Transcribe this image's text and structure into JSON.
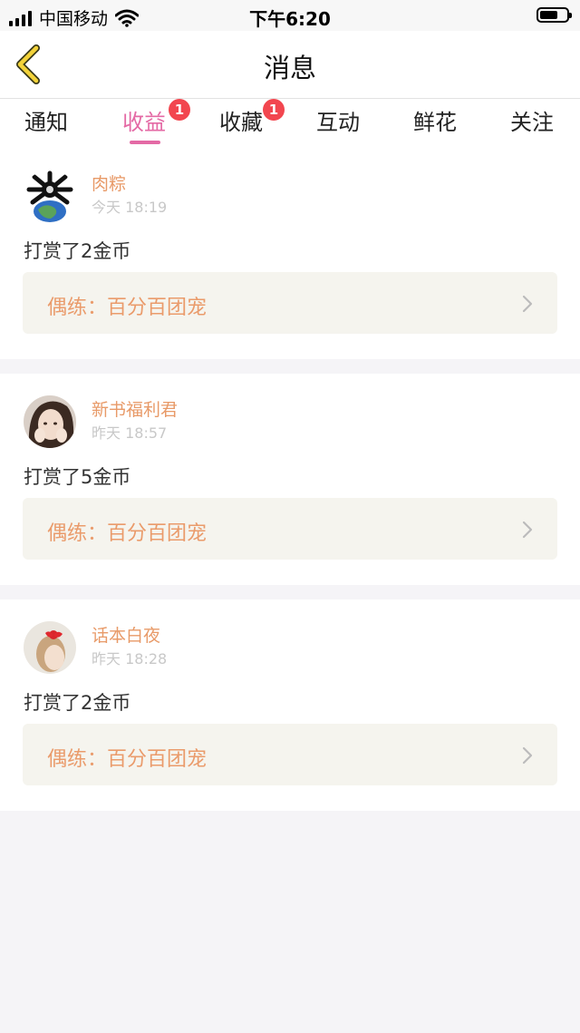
{
  "status_bar": {
    "carrier": "中国移动",
    "time": "下午6:20"
  },
  "nav": {
    "title": "消息"
  },
  "tabs": [
    {
      "label": "通知",
      "badge": ""
    },
    {
      "label": "收益",
      "badge": "1",
      "active": true
    },
    {
      "label": "收藏",
      "badge": "1"
    },
    {
      "label": "互动",
      "badge": ""
    },
    {
      "label": "鲜花",
      "badge": ""
    },
    {
      "label": "关注",
      "badge": ""
    }
  ],
  "messages": [
    {
      "user": "肉粽",
      "time": "今天 18:19",
      "action": "打赏了2金币",
      "link": "偶练：百分百团宠"
    },
    {
      "user": "新书福利君",
      "time": "昨天 18:57",
      "action": "打赏了5金币",
      "link": "偶练：百分百团宠"
    },
    {
      "user": "话本白夜",
      "time": "昨天 18:28",
      "action": "打赏了2金币",
      "link": "偶练：百分百团宠"
    }
  ],
  "colors": {
    "accent": "#e46aa5",
    "badge": "#f2464f",
    "username": "#e89a68",
    "back_arrow": "#f3d33a"
  }
}
